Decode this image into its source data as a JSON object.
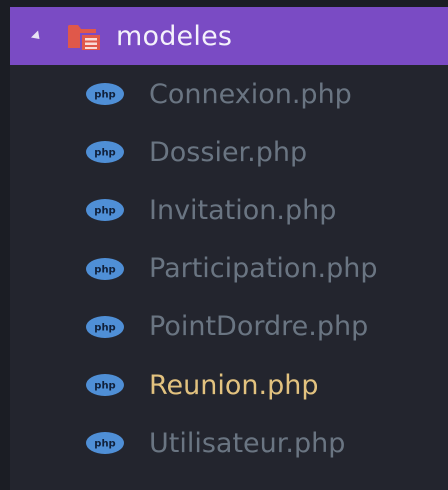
{
  "folder": {
    "name": "modeles",
    "icon": "folder-icon",
    "expanded": true
  },
  "files": [
    {
      "name": "Connexion.php",
      "icon": "php-icon",
      "active": false
    },
    {
      "name": "Dossier.php",
      "icon": "php-icon",
      "active": false
    },
    {
      "name": "Invitation.php",
      "icon": "php-icon",
      "active": false
    },
    {
      "name": "Participation.php",
      "icon": "php-icon",
      "active": false
    },
    {
      "name": "PointDordre.php",
      "icon": "php-icon",
      "active": false
    },
    {
      "name": "Reunion.php",
      "icon": "php-icon",
      "active": true
    },
    {
      "name": "Utilisateur.php",
      "icon": "php-icon",
      "active": false
    }
  ],
  "colors": {
    "selected_row": "#7a4bc4",
    "folder_icon": "#e0584a",
    "php_icon": "#4f8fd6",
    "file_text": "#6a7582",
    "active_file_text": "#e2c27f",
    "background": "#23252e"
  }
}
